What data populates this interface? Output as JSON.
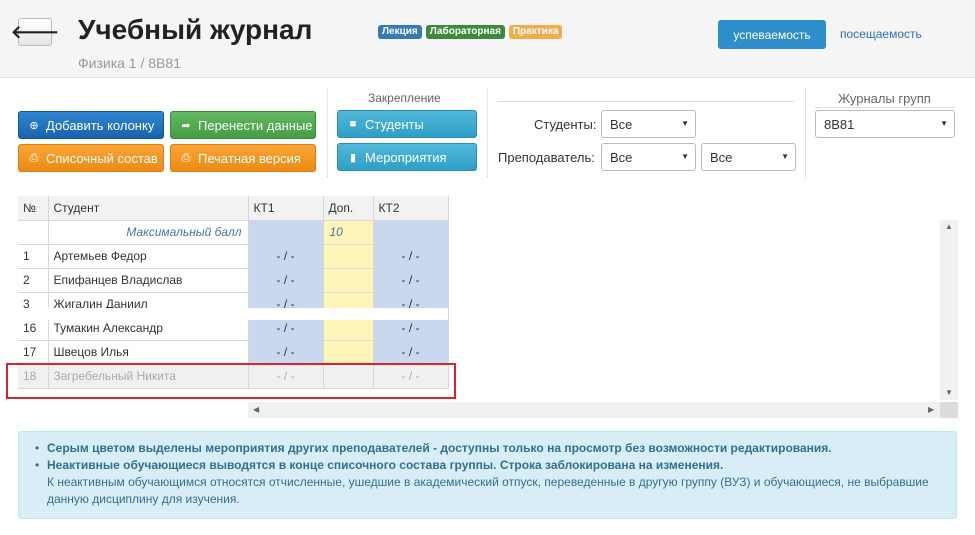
{
  "header": {
    "back_icon": "arrow-left-icon",
    "title": "Учебный журнал",
    "subtitle": "Физика 1 / 8В81",
    "badges": [
      {
        "label": "Лекция",
        "color": "#337ab7"
      },
      {
        "label": "Лабораторная",
        "color": "#3c8a3c"
      },
      {
        "label": "Практика",
        "color": "#f0ad4e"
      }
    ],
    "performance_label": "успеваемость",
    "attendance_label": "посещаемость"
  },
  "toolbar": {
    "add_column": "Добавить колонку",
    "transfer": "Перенести данные",
    "list": "Списочный состав",
    "print": "Печатная версия",
    "pin_label": "Закрепление",
    "students_btn": "Студенты",
    "events_btn": "Мероприятия",
    "students_filter_label": "Студенты:",
    "students_filter_value": "Все",
    "teacher_filter_label": "Преподаватель:",
    "teacher_filter_value": "Все",
    "teacher_filter_value2": "Все",
    "groups_label": "Журналы групп",
    "group_value": "8В81"
  },
  "table": {
    "headers": [
      "№",
      "Студент",
      "КТ1",
      "Доп.",
      "КТ2"
    ],
    "max_label": "Максимальный балл",
    "max_dop": "10",
    "rows": [
      {
        "no": "1",
        "name": "Артемьев Федор",
        "kt1": "- / -",
        "dop": "",
        "kt2": "- / -"
      },
      {
        "no": "2",
        "name": "Епифанцев Владислав",
        "kt1": "- / -",
        "dop": "",
        "kt2": "- / -"
      },
      {
        "no": "3",
        "name": "Жигалин Даниил",
        "kt1": "- / -",
        "dop": "",
        "kt2": "- / -"
      },
      {
        "no": "16",
        "name": "Тумакин Александр",
        "kt1": "- / -",
        "dop": "",
        "kt2": "- / -"
      },
      {
        "no": "17",
        "name": "Швецов Илья",
        "kt1": "- / -",
        "dop": "",
        "kt2": "- / -"
      }
    ],
    "inactive_row": {
      "no": "18",
      "name": "Загребельный Никита",
      "kt1": "- / -",
      "dop": "",
      "kt2": "- / -"
    }
  },
  "info": {
    "line1": "Серым цветом выделены мероприятия других преподавателей - доступны только на просмотр без возможности редактирования.",
    "line2": "Неактивные обучающиеся выводятся в конце списочного состава группы. Строка заблокирована на изменения.",
    "line3": "К неактивным обучающимся относятся отчисленные, ушедшие в академический отпуск, переведенные в другую группу (ВУЗ) и обучающиеся, не выбравшие данную дисциплину для изучения."
  }
}
